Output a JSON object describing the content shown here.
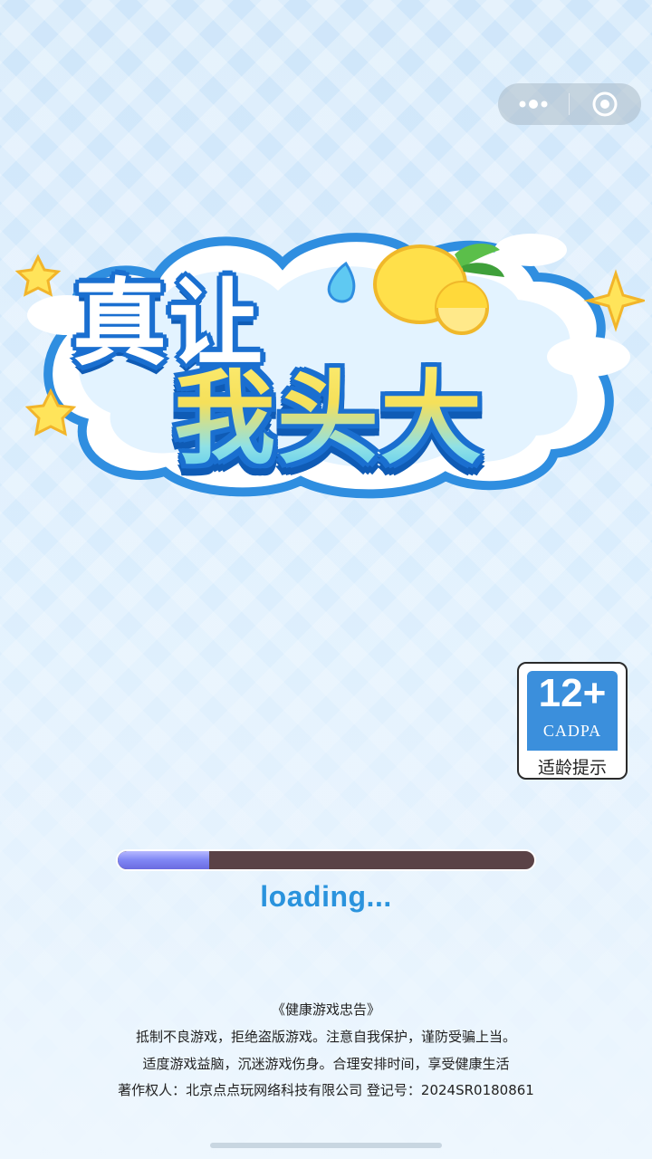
{
  "capsule": {
    "more_icon": "more-dots-icon",
    "close_icon": "target-circle-icon"
  },
  "logo": {
    "line1": "真让",
    "line2": "我头大"
  },
  "age_rating": {
    "number": "12+",
    "org": "CADPA",
    "tip": "适龄提示",
    "color": "#3b8fdc"
  },
  "progress": {
    "percent": 22,
    "fill_color": "#7f86f4",
    "track_color": "#5a4246"
  },
  "loading_text": "loading...",
  "health_notice": {
    "title": "《健康游戏忠告》",
    "line1": "抵制不良游戏，拒绝盗版游戏。注意自我保护，谨防受骗上当。",
    "line2": "适度游戏益脑，沉迷游戏伤身。合理安排时间，享受健康生活"
  },
  "copyright": "著作权人：北京点点玩网络科技有限公司  登记号：2024SR0180861"
}
